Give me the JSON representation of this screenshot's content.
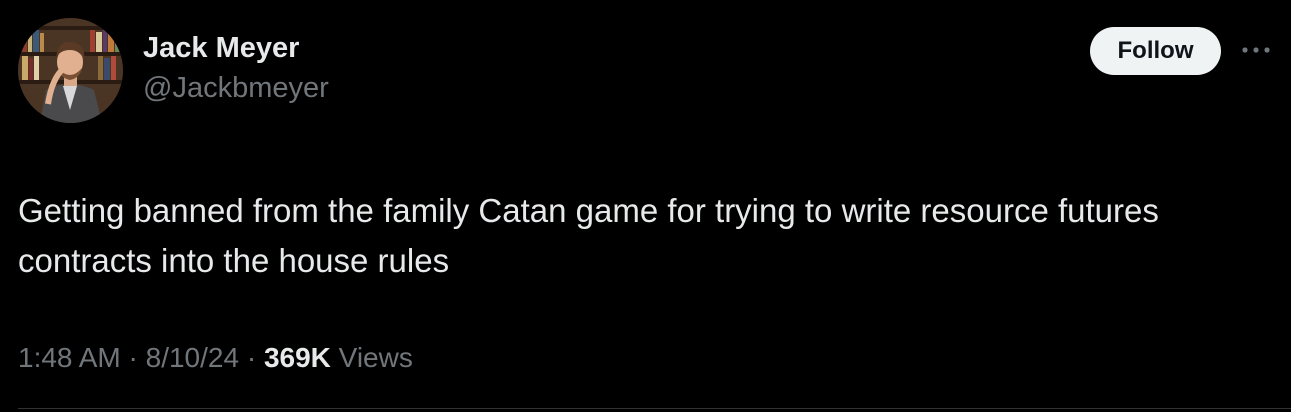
{
  "author": {
    "display_name": "Jack Meyer",
    "handle": "@Jackbmeyer",
    "avatar_icon": "profile-photo"
  },
  "actions": {
    "follow_label": "Follow",
    "more_icon": "more-horizontal-icon"
  },
  "tweet": {
    "text": "Getting banned from the family Catan game for trying to write resource futures contracts into the house rules"
  },
  "meta": {
    "time": "1:48 AM",
    "separator": "·",
    "date": "8/10/24",
    "views_count": "369K",
    "views_label": "Views"
  },
  "colors": {
    "background": "#000000",
    "primary_text": "#e7e9ea",
    "secondary_text": "#71767b",
    "follow_bg": "#eff3f4",
    "follow_text": "#0f1419",
    "divider": "#2f3336"
  }
}
